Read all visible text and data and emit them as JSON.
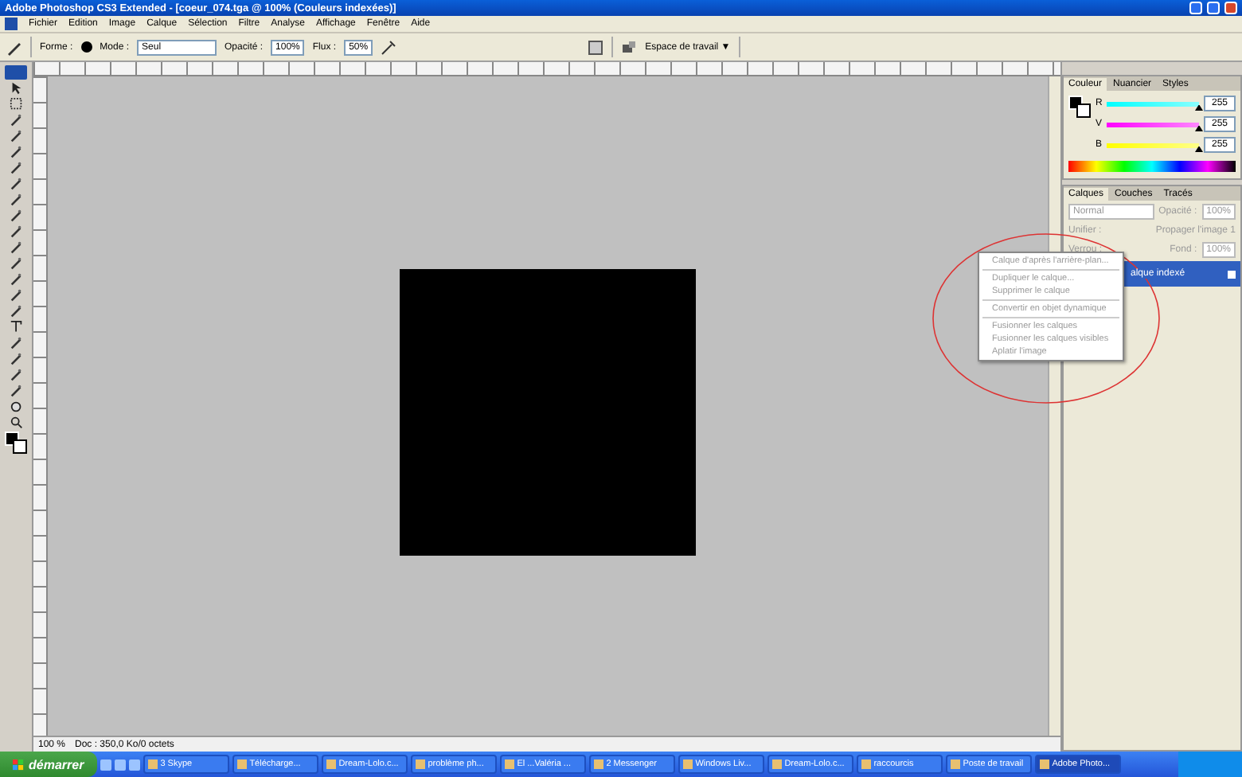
{
  "window": {
    "title": "Adobe Photoshop CS3 Extended - [coeur_074.tga @ 100% (Couleurs indexées)]"
  },
  "menu": [
    "Fichier",
    "Edition",
    "Image",
    "Calque",
    "Sélection",
    "Filtre",
    "Analyse",
    "Affichage",
    "Fenêtre",
    "Aide"
  ],
  "options_bar": {
    "shape_label": "Forme :",
    "mode_label": "Mode :",
    "mode_value": "Seul",
    "opacity_label": "Opacité :",
    "opacity_value": "100%",
    "flow_label": "Flux :",
    "flow_value": "50%",
    "workspace": "Espace de travail ▼"
  },
  "status_bar": {
    "zoom": "100 %",
    "doc": "Doc : 350,0 Ko/0 octets"
  },
  "color_panel": {
    "tabs": [
      {
        "label": "Couleur",
        "selected": true
      },
      {
        "label": "Nuancier",
        "selected": false
      },
      {
        "label": "Styles",
        "selected": false
      }
    ],
    "channels": [
      {
        "name": "R",
        "value": "255",
        "level": 1.0
      },
      {
        "name": "V",
        "value": "255",
        "level": 1.0
      },
      {
        "name": "B",
        "value": "255",
        "level": 1.0
      }
    ]
  },
  "layers_panel": {
    "tabs": [
      {
        "label": "Calques",
        "selected": true
      },
      {
        "label": "Couches",
        "selected": false
      },
      {
        "label": "Tracés",
        "selected": false
      }
    ],
    "blend_mode": "Normal",
    "opacity_label": "Opacité :",
    "opacity_value": "100%",
    "unify_label": "Unifier :",
    "propagate_label": "Propager l'image 1",
    "lock_label": "Verrou :",
    "fill_label": "Fond :",
    "fill_value": "100%",
    "layers": [
      {
        "name": "alque indexé",
        "selected": true
      }
    ]
  },
  "context_menu": {
    "groups": [
      [
        {
          "label": "Calque d'après l'arrière-plan...",
          "disabled": true
        }
      ],
      [
        {
          "label": "Dupliquer le calque...",
          "disabled": true
        },
        {
          "label": "Supprimer le calque",
          "disabled": true
        }
      ],
      [
        {
          "label": "Convertir en objet dynamique",
          "disabled": true
        }
      ],
      [
        {
          "label": "Fusionner les calques",
          "disabled": true
        },
        {
          "label": "Fusionner les calques visibles",
          "disabled": true
        },
        {
          "label": "Aplatir l'image",
          "disabled": true
        }
      ]
    ]
  },
  "taskbar": {
    "start": "démarrer",
    "items": [
      {
        "label": "3 Skype",
        "selected": false
      },
      {
        "label": "Télécharge...",
        "selected": false
      },
      {
        "label": "Dream-Lolo.c...",
        "selected": false
      },
      {
        "label": "problème ph...",
        "selected": false
      },
      {
        "label": "El ...Valéria ...",
        "selected": false
      },
      {
        "label": "2 Messenger",
        "selected": false
      },
      {
        "label": "Windows Liv...",
        "selected": false
      },
      {
        "label": "Dream-Lolo.c...",
        "selected": false
      },
      {
        "label": "raccourcis",
        "selected": false
      },
      {
        "label": "Poste de travail",
        "selected": false
      },
      {
        "label": "Adobe Photo...",
        "selected": true
      }
    ]
  }
}
